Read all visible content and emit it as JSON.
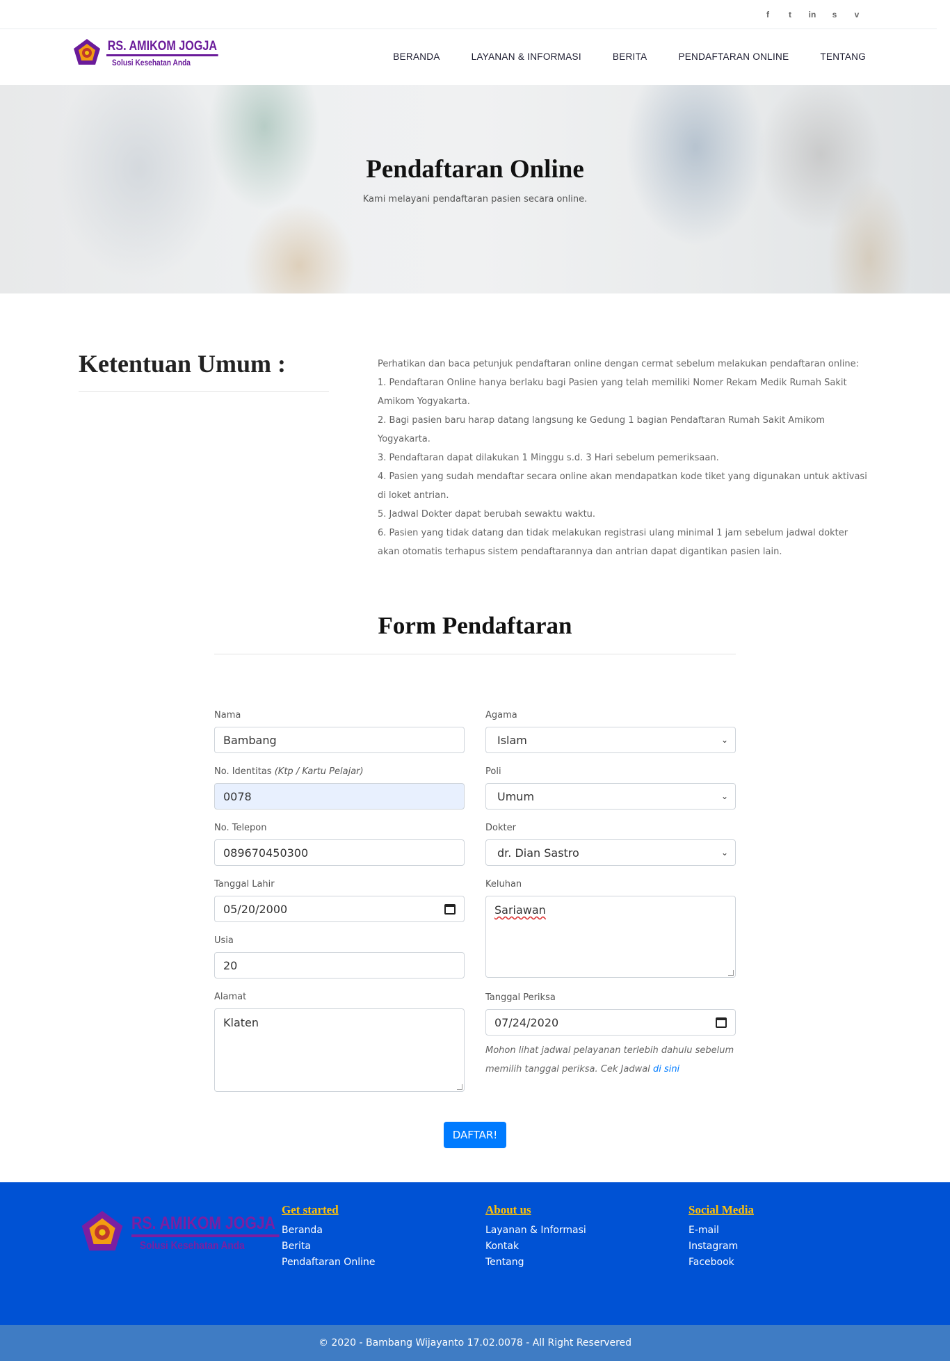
{
  "social_top": [
    {
      "icon": "facebook-icon",
      "glyph": "f"
    },
    {
      "icon": "twitter-icon",
      "glyph": "t"
    },
    {
      "icon": "linkedin-icon",
      "glyph": "in"
    },
    {
      "icon": "skype-icon",
      "glyph": "s"
    },
    {
      "icon": "vimeo-icon",
      "glyph": "v"
    }
  ],
  "brand": {
    "title": "RS. AMIKOM JOGJA",
    "subtitle": "Solusi Kesehatan Anda"
  },
  "nav": [
    "BERANDA",
    "LAYANAN & INFORMASI",
    "BERITA",
    "PENDAFTARAN ONLINE",
    "TENTANG"
  ],
  "hero": {
    "title": "Pendaftaran Online",
    "subtitle": "Kami melayani pendaftaran pasien secara online."
  },
  "ketentuan": {
    "title": "Ketentuan Umum :",
    "intro": "Perhatikan dan baca petunjuk pendaftaran online dengan cermat sebelum melakukan pendaftaran online:",
    "items": [
      "1. Pendaftaran Online hanya berlaku bagi Pasien yang telah memiliki Nomer Rekam Medik Rumah Sakit Amikom Yogyakarta.",
      "2. Bagi pasien baru harap datang langsung ke Gedung 1 bagian Pendaftaran Rumah Sakit Amikom Yogyakarta.",
      "3. Pendaftaran dapat dilakukan 1 Minggu s.d. 3 Hari sebelum pemeriksaan.",
      "4. Pasien yang sudah mendaftar secara online akan mendapatkan kode tiket yang digunakan untuk aktivasi di loket antrian.",
      "5. Jadwal Dokter dapat berubah sewaktu waktu.",
      "6. Pasien yang tidak datang dan tidak melakukan registrasi ulang minimal 1 jam sebelum jadwal dokter akan otomatis terhapus sistem pendaftarannya dan antrian dapat digantikan pasien lain."
    ]
  },
  "form": {
    "title": "Form Pendaftaran",
    "nama": {
      "label": "Nama",
      "value": "Bambang"
    },
    "identitas": {
      "label": "No. Identitas",
      "hint": "(Ktp / Kartu Pelajar)",
      "value": "0078"
    },
    "telepon": {
      "label": "No. Telepon",
      "value": "089670450300"
    },
    "tgl_lahir": {
      "label": "Tanggal Lahir",
      "value": "05/20/2000"
    },
    "usia": {
      "label": "Usia",
      "value": "20"
    },
    "alamat": {
      "label": "Alamat",
      "value": "Klaten"
    },
    "agama": {
      "label": "Agama",
      "value": "Islam"
    },
    "poli": {
      "label": "Poli",
      "value": "Umum"
    },
    "dokter": {
      "label": "Dokter",
      "value": "dr. Dian Sastro"
    },
    "keluhan": {
      "label": "Keluhan",
      "value": "Sariawan"
    },
    "tgl_periksa": {
      "label": "Tanggal Periksa",
      "value": "07/24/2020"
    },
    "note": "Mohon lihat jadwal pelayanan terlebih dahulu sebelum memilih tanggal periksa. Cek Jadwal",
    "note_link": "di sini",
    "submit": "DAFTAR!"
  },
  "footer": {
    "brand": {
      "title": "RS. AMIKOM JOGJA",
      "subtitle": "Solusi Kesehatan Anda"
    },
    "columns": [
      {
        "title": "Get started",
        "links": [
          "Beranda",
          "Berita",
          "Pendaftaran Online"
        ]
      },
      {
        "title": "About us",
        "links": [
          "Layanan & Informasi",
          "Kontak",
          "Tentang"
        ]
      },
      {
        "title": "Social Media",
        "links": [
          "E-mail",
          "Instagram",
          "Facebook"
        ]
      }
    ],
    "copyright": "© 2020 - Bambang Wijayanto 17.02.0078 - All Right Reservered"
  },
  "colors": {
    "primary": "#007bff",
    "footer_bg": "#0052d4",
    "copyright_bg": "#3f7cc4",
    "brand_purple": "#6a1b9a",
    "footer_heading": "#ffc107"
  }
}
